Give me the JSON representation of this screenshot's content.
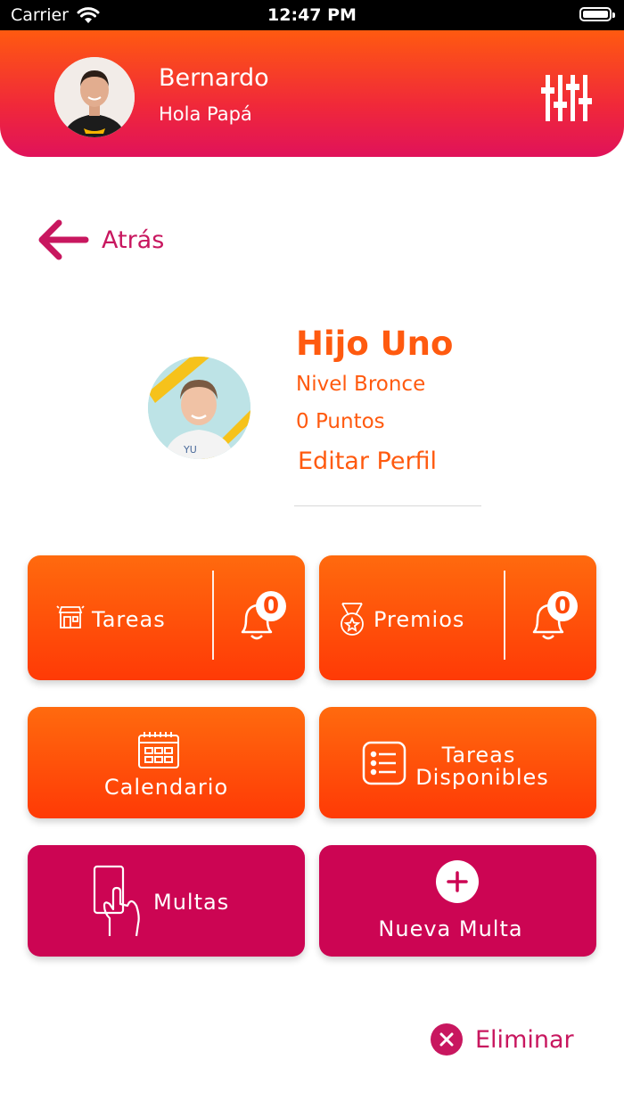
{
  "status_bar": {
    "carrier": "Carrier",
    "time": "12:47 PM"
  },
  "header": {
    "user_name": "Bernardo",
    "greeting": "Hola Papá"
  },
  "nav": {
    "back_label": "Atrás"
  },
  "profile": {
    "name": "Hijo Uno",
    "level": "Nivel Bronce",
    "points": "0 Puntos",
    "edit_label": "Editar Perfil"
  },
  "tiles": {
    "tareas": {
      "label": "Tareas",
      "count": "0"
    },
    "premios": {
      "label": "Premios",
      "count": "0"
    },
    "calendario": {
      "label": "Calendario"
    },
    "tareas_disponibles": {
      "line1": "Tareas",
      "line2": "Disponibles"
    },
    "multas": {
      "label": "Multas"
    },
    "nueva_multa": {
      "label": "Nueva Multa"
    }
  },
  "actions": {
    "delete_label": "Eliminar"
  },
  "colors": {
    "orange": "#ff5a0f",
    "magenta": "#cc0553",
    "accent_text": "#c8175f"
  }
}
